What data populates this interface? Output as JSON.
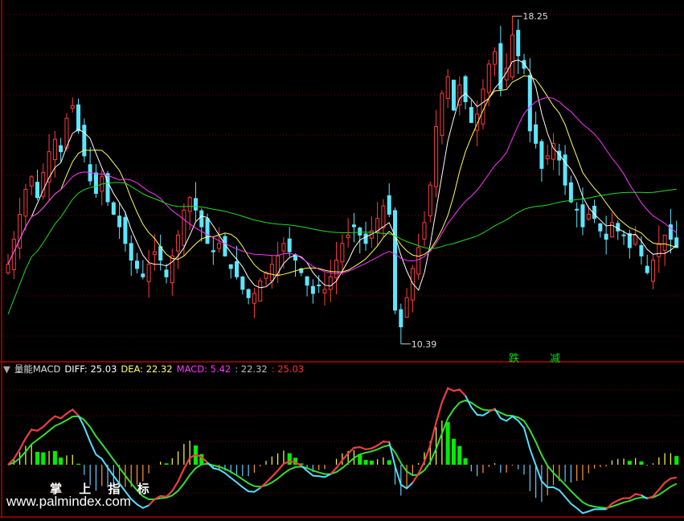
{
  "colors": {
    "background": "#000000",
    "frame": "#b40000",
    "grid": "#7a0000",
    "up": "#ff3c3c",
    "down": "#5ee6ff",
    "ma_short": "#ffffff",
    "ma_mid": "#ffff55",
    "ma_long": "#ff33ff",
    "ma_xlong": "#22dd22",
    "diff_line": "#55ddff",
    "dea_line": "#ff3333",
    "macd_pos": "#00ee00",
    "macd_pos_alt": "#ffff44",
    "macd_neg": "#66ccff",
    "macd_neg_alt": "#ff9933"
  },
  "price_panel": {
    "high_label": "18.25",
    "low_label": "10.39",
    "signals": [
      "跌",
      "减"
    ]
  },
  "indicator_panel": {
    "name": "量能MACD",
    "diff_label": "DIFF: 25.03",
    "dea_label": "DEA: 22.32",
    "macd_label": "MACD: 5.42",
    "extra1_label": ": 22.32",
    "extra2_label": ": 25.03"
  },
  "watermark": {
    "title": "掌 上 指 标",
    "url": "www.palmindex.com"
  },
  "chart_data": [
    {
      "type": "candlestick",
      "title": "",
      "ylim": [
        10.0,
        18.6
      ],
      "max_price": 18.25,
      "min_price": 10.39,
      "grid": true,
      "closes": [
        12.3,
        12.9,
        13.5,
        14.1,
        14.4,
        13.9,
        14.5,
        15.0,
        15.3,
        15.0,
        15.8,
        16.1,
        15.5,
        14.9,
        14.3,
        14.0,
        14.4,
        13.8,
        13.5,
        13.2,
        12.8,
        12.4,
        12.2,
        12.0,
        12.3,
        12.6,
        12.4,
        12.0,
        12.5,
        13.0,
        13.6,
        13.9,
        13.6,
        13.2,
        12.8,
        12.6,
        12.8,
        12.5,
        12.2,
        12.0,
        11.7,
        11.5,
        11.6,
        11.9,
        12.1,
        12.3,
        12.5,
        12.8,
        12.6,
        12.4,
        12.1,
        11.8,
        11.6,
        11.8,
        11.7,
        12.0,
        12.4,
        12.8,
        13.0,
        13.2,
        13.0,
        12.8,
        13.1,
        13.4,
        13.7,
        13.5,
        11.2,
        10.8,
        11.5,
        12.2,
        12.7,
        13.3,
        14.2,
        15.6,
        16.4,
        16.8,
        16.0,
        16.6,
        16.2,
        15.7,
        15.9,
        16.5,
        17.1,
        17.4,
        16.5,
        17.0,
        17.8,
        17.3,
        17.0,
        15.5,
        15.2,
        14.6,
        14.9,
        15.2,
        14.8,
        14.2,
        13.8,
        13.6,
        13.2,
        13.5,
        13.4,
        13.1,
        12.9,
        13.3,
        13.1,
        13.0,
        12.7,
        13.0,
        12.5,
        12.1,
        12.4,
        12.8,
        13.0,
        12.9,
        12.7
      ],
      "ma_periods": [
        5,
        10,
        20,
        60
      ]
    },
    {
      "type": "macd",
      "title": "量能MACD",
      "ylim": [
        -30,
        36
      ],
      "series": [
        {
          "name": "DIFF",
          "last": 25.03
        },
        {
          "name": "DEA",
          "last": 22.32
        },
        {
          "name": "MACD",
          "last": 5.42
        }
      ]
    }
  ]
}
